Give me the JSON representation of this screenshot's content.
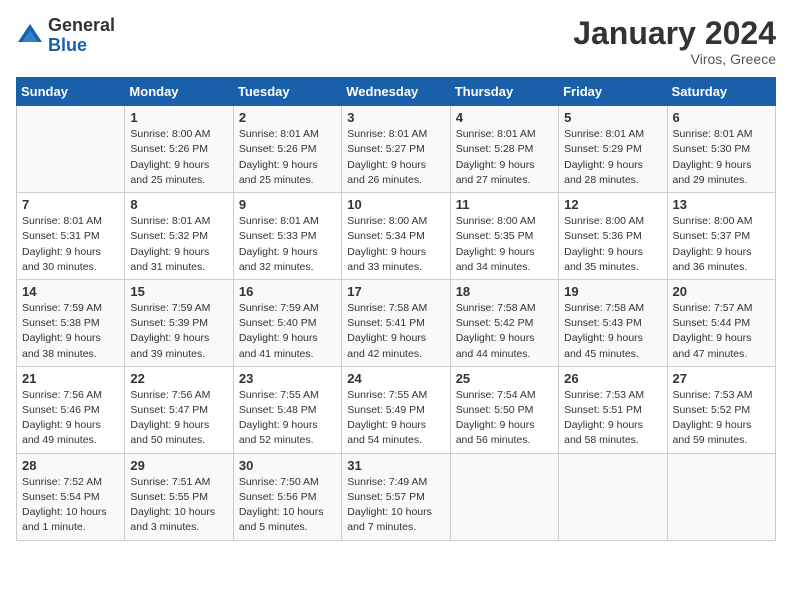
{
  "header": {
    "logo_line1": "General",
    "logo_line2": "Blue",
    "month": "January 2024",
    "location": "Viros, Greece"
  },
  "weekdays": [
    "Sunday",
    "Monday",
    "Tuesday",
    "Wednesday",
    "Thursday",
    "Friday",
    "Saturday"
  ],
  "weeks": [
    [
      {
        "day": "",
        "sunrise": "",
        "sunset": "",
        "daylight": ""
      },
      {
        "day": "1",
        "sunrise": "Sunrise: 8:00 AM",
        "sunset": "Sunset: 5:26 PM",
        "daylight": "Daylight: 9 hours and 25 minutes."
      },
      {
        "day": "2",
        "sunrise": "Sunrise: 8:01 AM",
        "sunset": "Sunset: 5:26 PM",
        "daylight": "Daylight: 9 hours and 25 minutes."
      },
      {
        "day": "3",
        "sunrise": "Sunrise: 8:01 AM",
        "sunset": "Sunset: 5:27 PM",
        "daylight": "Daylight: 9 hours and 26 minutes."
      },
      {
        "day": "4",
        "sunrise": "Sunrise: 8:01 AM",
        "sunset": "Sunset: 5:28 PM",
        "daylight": "Daylight: 9 hours and 27 minutes."
      },
      {
        "day": "5",
        "sunrise": "Sunrise: 8:01 AM",
        "sunset": "Sunset: 5:29 PM",
        "daylight": "Daylight: 9 hours and 28 minutes."
      },
      {
        "day": "6",
        "sunrise": "Sunrise: 8:01 AM",
        "sunset": "Sunset: 5:30 PM",
        "daylight": "Daylight: 9 hours and 29 minutes."
      }
    ],
    [
      {
        "day": "7",
        "sunrise": "Sunrise: 8:01 AM",
        "sunset": "Sunset: 5:31 PM",
        "daylight": "Daylight: 9 hours and 30 minutes."
      },
      {
        "day": "8",
        "sunrise": "Sunrise: 8:01 AM",
        "sunset": "Sunset: 5:32 PM",
        "daylight": "Daylight: 9 hours and 31 minutes."
      },
      {
        "day": "9",
        "sunrise": "Sunrise: 8:01 AM",
        "sunset": "Sunset: 5:33 PM",
        "daylight": "Daylight: 9 hours and 32 minutes."
      },
      {
        "day": "10",
        "sunrise": "Sunrise: 8:00 AM",
        "sunset": "Sunset: 5:34 PM",
        "daylight": "Daylight: 9 hours and 33 minutes."
      },
      {
        "day": "11",
        "sunrise": "Sunrise: 8:00 AM",
        "sunset": "Sunset: 5:35 PM",
        "daylight": "Daylight: 9 hours and 34 minutes."
      },
      {
        "day": "12",
        "sunrise": "Sunrise: 8:00 AM",
        "sunset": "Sunset: 5:36 PM",
        "daylight": "Daylight: 9 hours and 35 minutes."
      },
      {
        "day": "13",
        "sunrise": "Sunrise: 8:00 AM",
        "sunset": "Sunset: 5:37 PM",
        "daylight": "Daylight: 9 hours and 36 minutes."
      }
    ],
    [
      {
        "day": "14",
        "sunrise": "Sunrise: 7:59 AM",
        "sunset": "Sunset: 5:38 PM",
        "daylight": "Daylight: 9 hours and 38 minutes."
      },
      {
        "day": "15",
        "sunrise": "Sunrise: 7:59 AM",
        "sunset": "Sunset: 5:39 PM",
        "daylight": "Daylight: 9 hours and 39 minutes."
      },
      {
        "day": "16",
        "sunrise": "Sunrise: 7:59 AM",
        "sunset": "Sunset: 5:40 PM",
        "daylight": "Daylight: 9 hours and 41 minutes."
      },
      {
        "day": "17",
        "sunrise": "Sunrise: 7:58 AM",
        "sunset": "Sunset: 5:41 PM",
        "daylight": "Daylight: 9 hours and 42 minutes."
      },
      {
        "day": "18",
        "sunrise": "Sunrise: 7:58 AM",
        "sunset": "Sunset: 5:42 PM",
        "daylight": "Daylight: 9 hours and 44 minutes."
      },
      {
        "day": "19",
        "sunrise": "Sunrise: 7:58 AM",
        "sunset": "Sunset: 5:43 PM",
        "daylight": "Daylight: 9 hours and 45 minutes."
      },
      {
        "day": "20",
        "sunrise": "Sunrise: 7:57 AM",
        "sunset": "Sunset: 5:44 PM",
        "daylight": "Daylight: 9 hours and 47 minutes."
      }
    ],
    [
      {
        "day": "21",
        "sunrise": "Sunrise: 7:56 AM",
        "sunset": "Sunset: 5:46 PM",
        "daylight": "Daylight: 9 hours and 49 minutes."
      },
      {
        "day": "22",
        "sunrise": "Sunrise: 7:56 AM",
        "sunset": "Sunset: 5:47 PM",
        "daylight": "Daylight: 9 hours and 50 minutes."
      },
      {
        "day": "23",
        "sunrise": "Sunrise: 7:55 AM",
        "sunset": "Sunset: 5:48 PM",
        "daylight": "Daylight: 9 hours and 52 minutes."
      },
      {
        "day": "24",
        "sunrise": "Sunrise: 7:55 AM",
        "sunset": "Sunset: 5:49 PM",
        "daylight": "Daylight: 9 hours and 54 minutes."
      },
      {
        "day": "25",
        "sunrise": "Sunrise: 7:54 AM",
        "sunset": "Sunset: 5:50 PM",
        "daylight": "Daylight: 9 hours and 56 minutes."
      },
      {
        "day": "26",
        "sunrise": "Sunrise: 7:53 AM",
        "sunset": "Sunset: 5:51 PM",
        "daylight": "Daylight: 9 hours and 58 minutes."
      },
      {
        "day": "27",
        "sunrise": "Sunrise: 7:53 AM",
        "sunset": "Sunset: 5:52 PM",
        "daylight": "Daylight: 9 hours and 59 minutes."
      }
    ],
    [
      {
        "day": "28",
        "sunrise": "Sunrise: 7:52 AM",
        "sunset": "Sunset: 5:54 PM",
        "daylight": "Daylight: 10 hours and 1 minute."
      },
      {
        "day": "29",
        "sunrise": "Sunrise: 7:51 AM",
        "sunset": "Sunset: 5:55 PM",
        "daylight": "Daylight: 10 hours and 3 minutes."
      },
      {
        "day": "30",
        "sunrise": "Sunrise: 7:50 AM",
        "sunset": "Sunset: 5:56 PM",
        "daylight": "Daylight: 10 hours and 5 minutes."
      },
      {
        "day": "31",
        "sunrise": "Sunrise: 7:49 AM",
        "sunset": "Sunset: 5:57 PM",
        "daylight": "Daylight: 10 hours and 7 minutes."
      },
      {
        "day": "",
        "sunrise": "",
        "sunset": "",
        "daylight": ""
      },
      {
        "day": "",
        "sunrise": "",
        "sunset": "",
        "daylight": ""
      },
      {
        "day": "",
        "sunrise": "",
        "sunset": "",
        "daylight": ""
      }
    ]
  ]
}
